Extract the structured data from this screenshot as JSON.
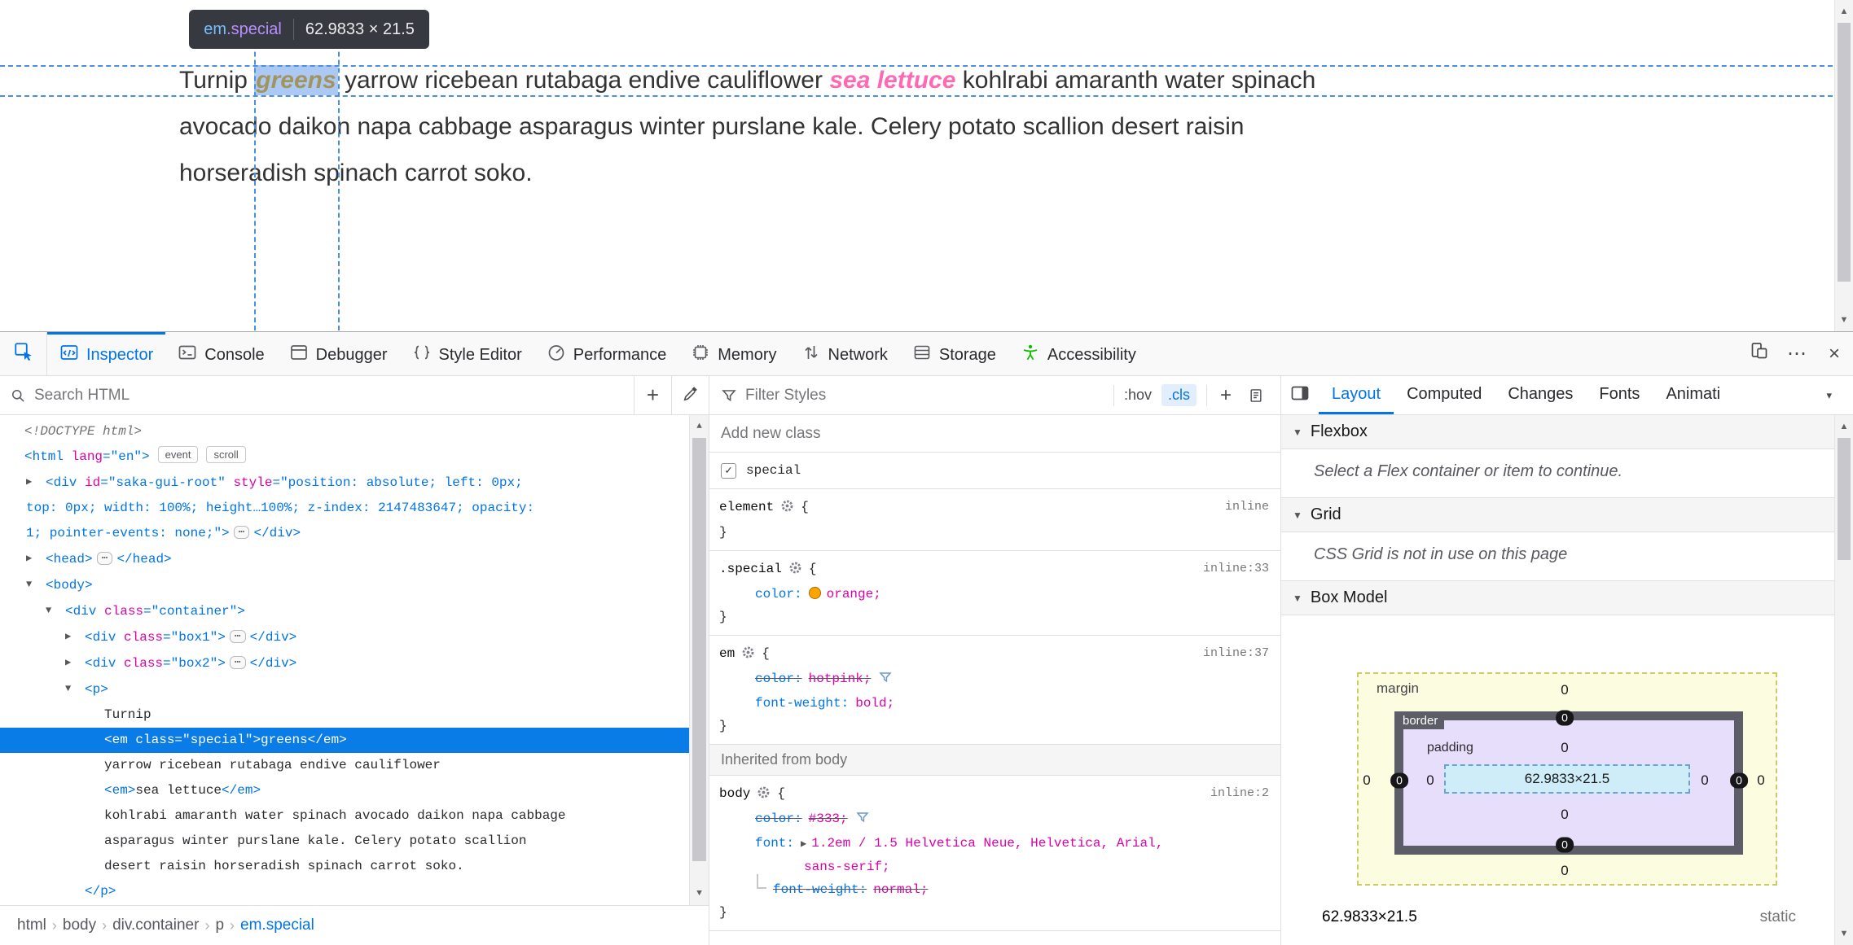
{
  "glyphs": {
    "expanded": "▼",
    "collapsed": "▶",
    "check": "✓",
    "crumb_sep": "›",
    "up": "▲",
    "down": "▼",
    "more": "⋯",
    "close": "×",
    "plus": "+",
    "alltabs": "▾"
  },
  "page": {
    "infobar": {
      "tag": "em",
      "class": ".special",
      "dims": "62.9833 × 21.5"
    },
    "text": {
      "t1": "Turnip ",
      "em_special": "greens",
      "t2": " yarrow ricebean rutabaga endive cauliflower ",
      "em_pink": "sea lettuce",
      "t3": " kohlrabi amaranth water spinach",
      "t4": "avocado daikon napa cabbage asparagus winter purslane kale. Celery potato scallion desert raisin",
      "t5": "horseradish spinach carrot soko."
    }
  },
  "toolbar": {
    "tabs": [
      {
        "label": "Inspector"
      },
      {
        "label": "Console"
      },
      {
        "label": "Debugger"
      },
      {
        "label": "Style Editor"
      },
      {
        "label": "Performance"
      },
      {
        "label": "Memory"
      },
      {
        "label": "Network"
      },
      {
        "label": "Storage"
      },
      {
        "label": "Accessibility"
      }
    ]
  },
  "markup": {
    "search_placeholder": "Search HTML",
    "breadcrumbs": [
      {
        "label": "html"
      },
      {
        "label": "body"
      },
      {
        "label": "div.container"
      },
      {
        "label": "p"
      },
      {
        "label": "em.special"
      }
    ],
    "rows": {
      "doctype": "<!DOCTYPE html!>",
      "html": {
        "t1": "<html ",
        "a1": "lang",
        "q1": "=\"",
        "v1": "en",
        "t2": "\">",
        "badge1": "event",
        "badge2": "scroll"
      },
      "saka": {
        "t1": "<div ",
        "a1": "id",
        "q1": "=\"",
        "v1": "saka-gui-root",
        "q2": "\" ",
        "a2": "style",
        "q3": "=\"",
        "v2a": "position: absolute; left: 0px;",
        "v2b": "top: 0px; width: 100%; height…100%; z-index: 2147483647; opacity:",
        "v2c": "1; pointer-events: none;",
        "t2": "\">",
        "ellipsis": "⋯",
        "t3": "</div>"
      },
      "head": {
        "t1": "<head>",
        "ellipsis": "⋯",
        "t2": "</head>"
      },
      "body": {
        "t1": "<body>"
      },
      "container": {
        "t1": "<div ",
        "a1": "class",
        "q1": "=\"",
        "v1": "container",
        "t2": "\">"
      },
      "box1": {
        "t1": "<div ",
        "a1": "class",
        "q1": "=\"",
        "v1": "box1",
        "t2": "\">",
        "ellipsis": "⋯",
        "t3": "</div>"
      },
      "box2": {
        "t1": "<div ",
        "a1": "class",
        "q1": "=\"",
        "v1": "box2",
        "t2": "\">",
        "ellipsis": "⋯",
        "t3": "</div>"
      },
      "p": {
        "t1": "<p>"
      },
      "text_turnip": "Turnip",
      "em_special": {
        "t1": "<em ",
        "a1": "class",
        "q1": "=\"",
        "v1": "special",
        "t2": "\">",
        "txt": "greens",
        "t3": "</em>"
      },
      "text_yarrow": "yarrow ricebean rutabaga endive cauliflower",
      "em_sea": {
        "t1": "<em>",
        "txt": "sea lettuce",
        "t2": "</em>"
      },
      "text_k1": "kohlrabi amaranth water spinach avocado daikon napa cabbage",
      "text_k2": "asparagus winter purslane kale. Celery potato scallion",
      "text_k3": "desert raisin horseradish spinach carrot soko.",
      "p_close": "</p>"
    }
  },
  "rules": {
    "filter_placeholder": "Filter Styles",
    "hov_label": ":hov",
    "cls_label": ".cls",
    "add_class_placeholder": "Add new class",
    "class_name": "special",
    "element_rule": {
      "selector": "element",
      "open": "{",
      "close": "}",
      "source": "inline"
    },
    "special_rule": {
      "selector": ".special",
      "open": "{",
      "close": "}",
      "source": "inline:33",
      "prop1": "color:",
      "val1": "orange;"
    },
    "em_rule": {
      "selector": "em",
      "open": "{",
      "close": "}",
      "source": "inline:37",
      "prop1": "color:",
      "val1": "hotpink;",
      "prop2": "font-weight:",
      "val2": "bold;"
    },
    "inherited_label": "Inherited from body",
    "body_rule": {
      "selector": "body",
      "open": "{",
      "close": "}",
      "source": "inline:2",
      "prop1": "color:",
      "val1": "#333;",
      "prop2": "font:",
      "val2a": "1.2em / 1.5 Helvetica Neue, Helvetica, Arial,",
      "val2b": "sans-serif;",
      "prop3": "font-weight:",
      "val3": "normal;"
    }
  },
  "layout": {
    "tabs": [
      {
        "label": "Layout"
      },
      {
        "label": "Computed"
      },
      {
        "label": "Changes"
      },
      {
        "label": "Fonts"
      },
      {
        "label": "Animati"
      }
    ],
    "flexbox": {
      "title": "Flexbox",
      "message": "Select a Flex container or item to continue."
    },
    "grid": {
      "title": "Grid",
      "message": "CSS Grid is not in use on this page"
    },
    "boxmodel": {
      "title": "Box Model",
      "margin_label": "margin",
      "border_label": "border",
      "padding_label": "padding",
      "content": "62.9833×21.5",
      "m_top": "0",
      "m_right": "0",
      "m_bottom": "0",
      "m_left": "0",
      "b_top": "0",
      "b_right": "0",
      "b_bottom": "0",
      "b_left": "0",
      "p_top": "0",
      "p_right": "0",
      "p_bottom": "0",
      "p_left": "0",
      "size": "62.9833×21.5",
      "position": "static"
    }
  }
}
